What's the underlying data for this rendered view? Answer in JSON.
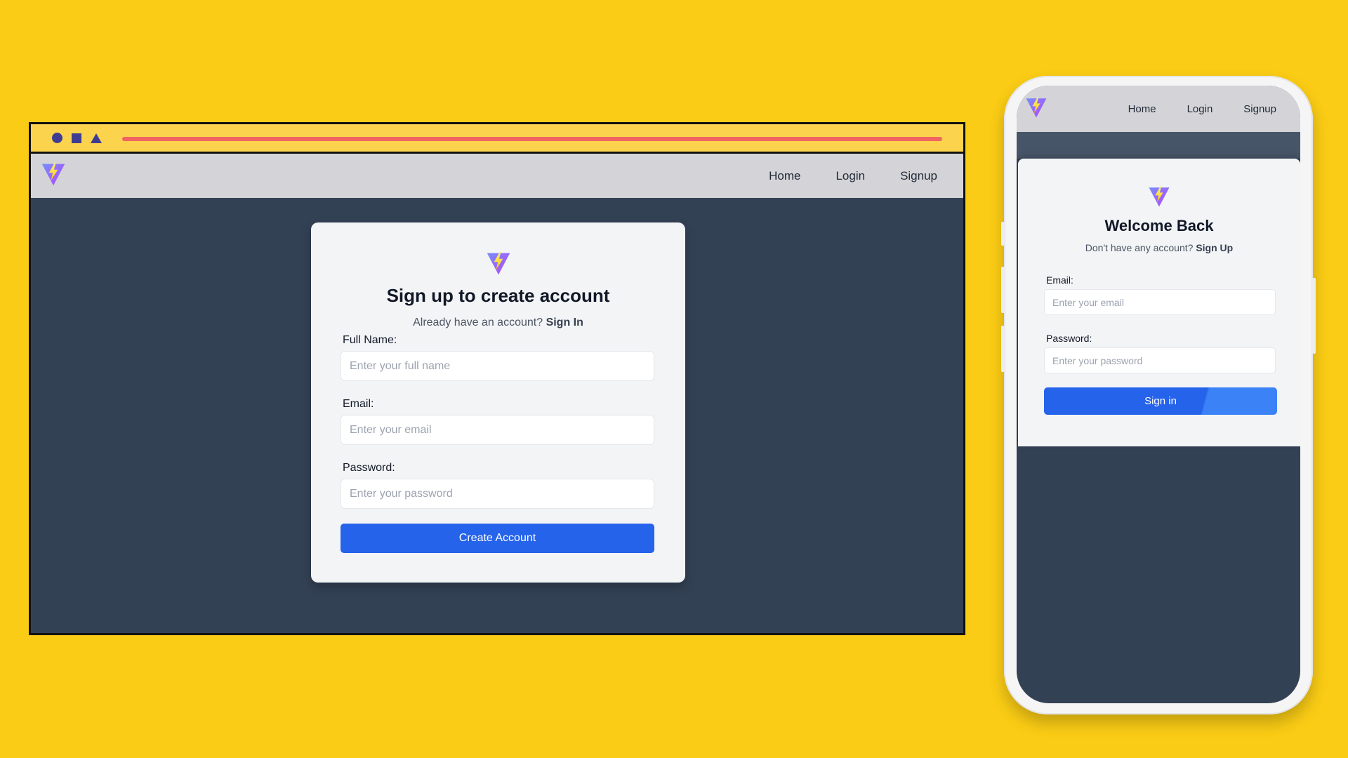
{
  "theme": {
    "page_background": "#FACC15",
    "browser_chrome": "#FCD34D",
    "chrome_shape_color": "#3F3D91",
    "address_bar_color": "#F06461",
    "navbar_background": "#D4D4D8",
    "app_background": "#334155",
    "card_background": "#F3F4F6",
    "button_color": "#2563EB"
  },
  "desktop": {
    "chrome": {
      "shapes": [
        "circle-icon",
        "square-icon",
        "triangle-icon"
      ]
    },
    "navbar": {
      "logo": "vite-logo-icon",
      "links": [
        "Home",
        "Login",
        "Signup"
      ]
    },
    "signup": {
      "logo": "vite-logo-icon",
      "title": "Sign up to create account",
      "subtitle_prefix": "Already have an account?",
      "subtitle_link": "Sign In",
      "fields": [
        {
          "label": "Full Name:",
          "placeholder": "Enter your full name",
          "value": ""
        },
        {
          "label": "Email:",
          "placeholder": "Enter your email",
          "value": ""
        },
        {
          "label": "Password:",
          "placeholder": "Enter your password",
          "value": ""
        }
      ],
      "submit_label": "Create Account"
    }
  },
  "mobile": {
    "navbar": {
      "logo": "vite-logo-icon",
      "links": [
        "Home",
        "Login",
        "Signup"
      ]
    },
    "signin": {
      "logo": "vite-logo-icon",
      "title": "Welcome Back",
      "subtitle_prefix": "Don't have any account?",
      "subtitle_link": "Sign Up",
      "fields": [
        {
          "label": "Email:",
          "placeholder": "Enter your email",
          "value": ""
        },
        {
          "label": "Password:",
          "placeholder": "Enter your password",
          "value": ""
        }
      ],
      "submit_label": "Sign in"
    }
  }
}
